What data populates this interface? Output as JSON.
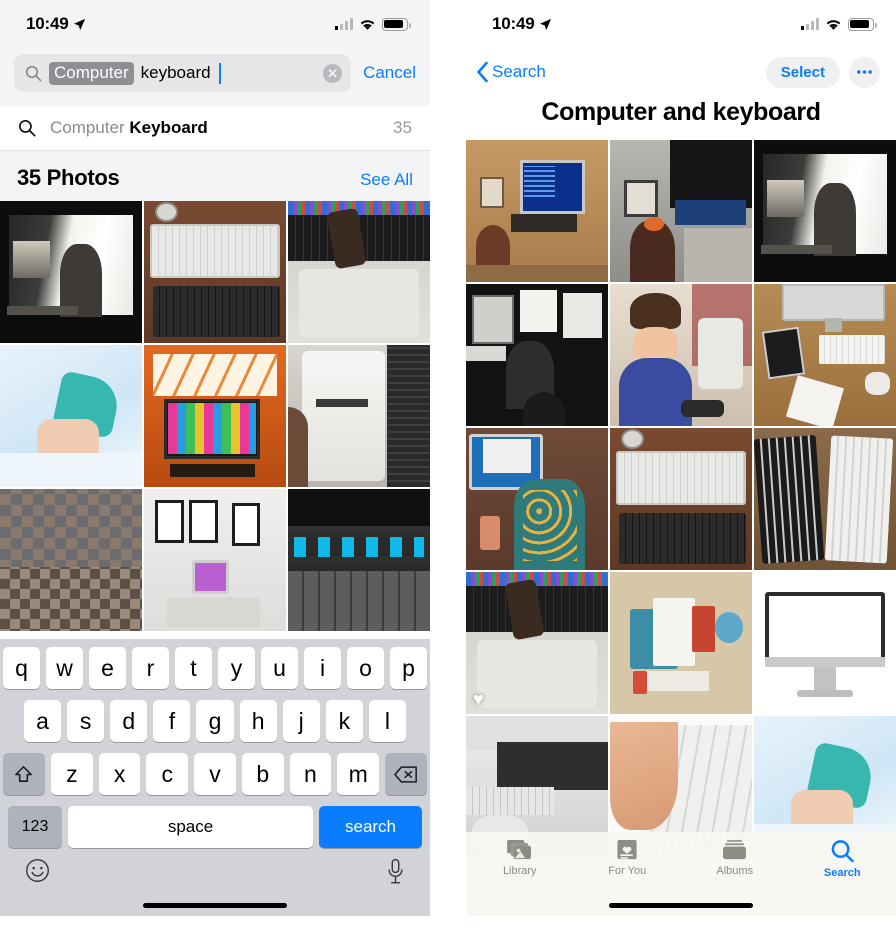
{
  "status_bar": {
    "time": "10:49",
    "location_icon": "location-arrow-icon",
    "cellular_icon": "cellular-bars-icon",
    "wifi_icon": "wifi-icon",
    "battery_icon": "battery-icon"
  },
  "left_screen": {
    "search": {
      "icon": "search-icon",
      "token": "Computer",
      "typed_text": "keyboard",
      "clear_icon": "clear-circle-icon",
      "cancel_label": "Cancel"
    },
    "suggestion": {
      "icon": "search-icon",
      "prefix": "Computer ",
      "bold": "Keyboard",
      "count": "35"
    },
    "section": {
      "title": "35 Photos",
      "see_all": "See All"
    },
    "photos": [
      {
        "alt": "bw-woman-at-imac-desk"
      },
      {
        "alt": "apple-wireless-keyboards-on-desk"
      },
      {
        "alt": "macbook-keyboard-with-watch"
      },
      {
        "alt": "hands-typing-on-laptop-bright"
      },
      {
        "alt": "rgb-monitor-orange-lit-room"
      },
      {
        "alt": "samsung-device-held-over-laptop"
      },
      {
        "alt": "pixelated-person-at-desk"
      },
      {
        "alt": "imac-desk-with-wall-art"
      },
      {
        "alt": "macbook-touch-bar-closeup"
      }
    ],
    "keyboard": {
      "row1": [
        "q",
        "w",
        "e",
        "r",
        "t",
        "y",
        "u",
        "i",
        "o",
        "p"
      ],
      "row2": [
        "a",
        "s",
        "d",
        "f",
        "g",
        "h",
        "j",
        "k",
        "l"
      ],
      "row3": [
        "z",
        "x",
        "c",
        "v",
        "b",
        "n",
        "m"
      ],
      "shift_icon": "shift-arrow-icon",
      "backspace_icon": "backspace-icon",
      "numbers_label": "123",
      "space_label": "space",
      "return_label": "search",
      "emoji_icon": "emoji-smiley-icon",
      "dictation_icon": "microphone-icon"
    }
  },
  "right_screen": {
    "nav": {
      "back_icon": "chevron-left-icon",
      "back_label": "Search",
      "select_label": "Select",
      "more_label": "•••",
      "more_icon": "ellipsis-icon"
    },
    "title": "Computer and  keyboard",
    "photos": [
      {
        "alt": "child-at-blue-screen-crt-desk"
      },
      {
        "alt": "kid-with-bow-at-dark-monitor"
      },
      {
        "alt": "bw-woman-at-imac-desk"
      },
      {
        "alt": "bw-person-at-imac-window"
      },
      {
        "alt": "smiling-man-blue-shirt-at-computer"
      },
      {
        "alt": "imac-wood-desk-keyboard-tablet"
      },
      {
        "alt": "girl-in-pyjamas-at-imac"
      },
      {
        "alt": "apple-wireless-keyboards-on-desk"
      },
      {
        "alt": "two-keyboards-black-and-white"
      },
      {
        "alt": "macbook-keyboard-with-watch",
        "favorite": true,
        "favorite_icon": "heart-icon"
      },
      {
        "alt": "illustration-elearning-desk"
      },
      {
        "alt": "imac-blank-white-screen"
      },
      {
        "alt": "bw-imac-keyboard-and-magic-mouse"
      },
      {
        "alt": "finger-pressing-white-keyboard"
      },
      {
        "alt": "hands-typing-on-laptop-bright"
      }
    ],
    "tabs": [
      {
        "label": "Library",
        "icon": "photos-library-icon",
        "active": false
      },
      {
        "label": "For You",
        "icon": "for-you-heart-card-icon",
        "active": false
      },
      {
        "label": "Albums",
        "icon": "albums-stack-icon",
        "active": false
      },
      {
        "label": "Search",
        "icon": "search-icon",
        "active": true
      }
    ]
  },
  "colors": {
    "accent_blue": "#0a7cff",
    "keyboard_bg": "#d1d3d9",
    "key_white": "#ffffff",
    "key_gray": "#adb2bd",
    "token_gray": "#8e8e93",
    "header_gray": "#f4f4f6"
  }
}
